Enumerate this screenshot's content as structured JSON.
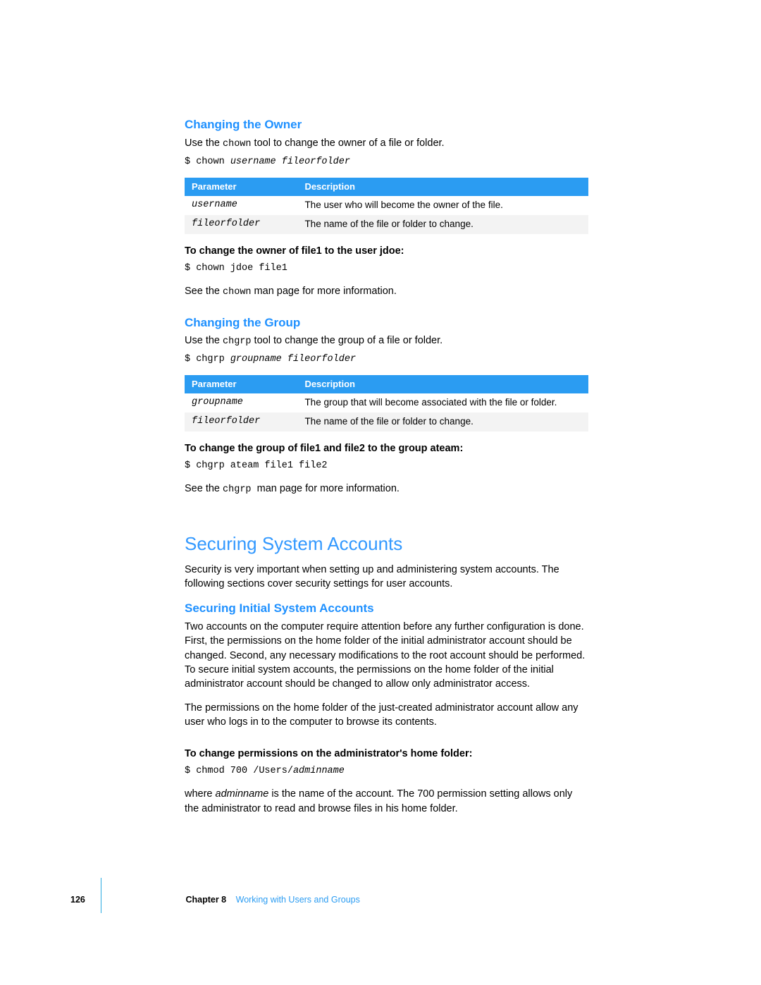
{
  "section1": {
    "title": "Changing the Owner",
    "intro_a": "Use the ",
    "intro_code": "chown",
    "intro_b": " tool to change the owner of a file or folder.",
    "cmd_prefix": "$ chown ",
    "cmd_args": "username fileorfolder",
    "table": {
      "h1": "Parameter",
      "h2": "Description",
      "rows": [
        {
          "p": "username",
          "d": "The user who will become the owner of the file."
        },
        {
          "p": "fileorfolder",
          "d": "The name of the file or folder to change."
        }
      ]
    },
    "task": "To change the owner of file1 to the user jdoe:",
    "task_cmd": "$ chown jdoe file1",
    "see_a": "See the ",
    "see_code": "chown",
    "see_b": " man page for more information."
  },
  "section2": {
    "title": "Changing the Group",
    "intro_a": "Use the ",
    "intro_code": "chgrp",
    "intro_b": " tool to change the group of a file or folder.",
    "cmd_prefix": "$ chgrp ",
    "cmd_args": "groupname fileorfolder",
    "table": {
      "h1": "Parameter",
      "h2": "Description",
      "rows": [
        {
          "p": "groupname",
          "d": "The group that will become associated with the file or folder."
        },
        {
          "p": "fileorfolder",
          "d": "The name of the file or folder to change."
        }
      ]
    },
    "task": "To change the group of file1 and file2 to the group ateam:",
    "task_cmd": "$ chgrp ateam file1 file2",
    "see_a": "See the ",
    "see_code": "chgrp ",
    "see_b": " man page for more information."
  },
  "section3": {
    "title": "Securing System Accounts",
    "intro": "Security is very important when setting up and administering system accounts. The following sections cover security settings for user accounts.",
    "sub_title": "Securing Initial System Accounts",
    "para1": "Two accounts on the computer require attention before any further configuration is done. First, the permissions on the home folder of the initial administrator account should be changed. Second, any necessary modifications to the root account should be performed. To secure initial system accounts, the permissions on the home folder of the initial administrator account should be changed to allow only administrator access.",
    "para2": "The permissions on the home folder of the just-created administrator account allow any user who logs in to the computer to browse its contents.",
    "task": "To change permissions on the administrator's home folder:",
    "cmd_prefix": "$ chmod 700 /Users/",
    "cmd_arg": "adminname",
    "para3_a": "where ",
    "para3_ital": "adminname",
    "para3_b": " is the name of the account. The 700 permission setting allows only the administrator to read and browse files in his home folder."
  },
  "footer": {
    "page": "126",
    "chapter": "Chapter 8",
    "title": "Working with Users and Groups"
  }
}
